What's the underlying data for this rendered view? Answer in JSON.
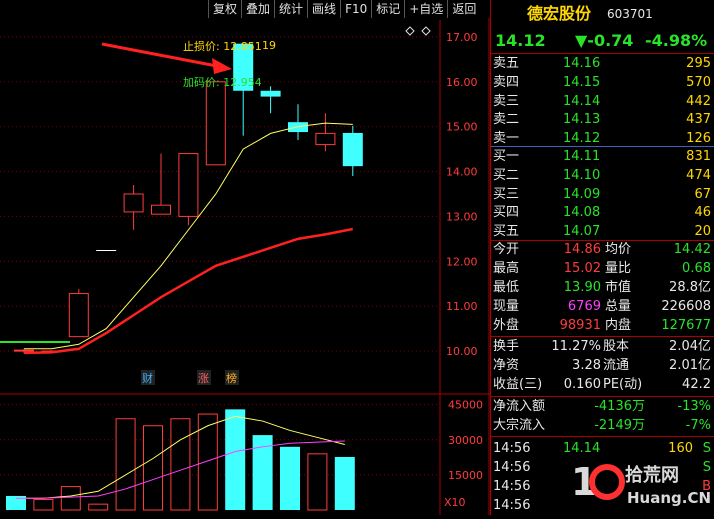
{
  "toolbar": [
    "复权",
    "叠加",
    "统计",
    "画线",
    "F10",
    "标记",
    "+自选",
    "返回"
  ],
  "stock": {
    "name": "德宏股份",
    "code": "603701",
    "price": "14.12",
    "change": "▼-0.74",
    "change_pct": "-4.98%"
  },
  "colors": {
    "up": "#ff3c3c",
    "down": "#40ffff",
    "ma1": "#ffff66",
    "ma2": "#ff2020",
    "vol_ma2": "#ff40ff",
    "grid": "#800000"
  },
  "sell": [
    {
      "label": "卖五",
      "price": "14.16",
      "vol": "295"
    },
    {
      "label": "卖四",
      "price": "14.15",
      "vol": "570"
    },
    {
      "label": "卖三",
      "price": "14.14",
      "vol": "442"
    },
    {
      "label": "卖二",
      "price": "14.13",
      "vol": "437"
    },
    {
      "label": "卖一",
      "price": "14.12",
      "vol": "126"
    }
  ],
  "buy": [
    {
      "label": "买一",
      "price": "14.11",
      "vol": "831"
    },
    {
      "label": "买二",
      "price": "14.10",
      "vol": "474"
    },
    {
      "label": "买三",
      "price": "14.09",
      "vol": "67"
    },
    {
      "label": "买四",
      "price": "14.08",
      "vol": "46"
    },
    {
      "label": "买五",
      "price": "14.07",
      "vol": "20"
    }
  ],
  "stats": [
    {
      "l1": "今开",
      "v1": "14.86",
      "c1": "red",
      "l2": "均价",
      "v2": "14.42",
      "c2": "green"
    },
    {
      "l1": "最高",
      "v1": "15.02",
      "c1": "red",
      "l2": "量比",
      "v2": "0.68",
      "c2": "green"
    },
    {
      "l1": "最低",
      "v1": "13.90",
      "c1": "green",
      "l2": "市值",
      "v2": "28.8亿",
      "c2": "white"
    },
    {
      "l1": "现量",
      "v1": "6769",
      "c1": "magenta",
      "l2": "总量",
      "v2": "226608",
      "c2": "white"
    },
    {
      "l1": "外盘",
      "v1": "98931",
      "c1": "red",
      "l2": "内盘",
      "v2": "127677",
      "c2": "green"
    }
  ],
  "fund": [
    {
      "l1": "换手",
      "v1": "11.27%",
      "l2": "股本",
      "v2": "2.04亿"
    },
    {
      "l1": "净资",
      "v1": "3.28",
      "l2": "流通",
      "v2": "2.01亿"
    },
    {
      "l1": "收益(三)",
      "v1": "0.160",
      "l2": "PE(动)",
      "v2": "42.2"
    }
  ],
  "flow": [
    {
      "label": "净流入额",
      "v1": "-4136万",
      "v2": "-13%"
    },
    {
      "label": "大宗流入",
      "v1": "-2149万",
      "v2": "-7%"
    }
  ],
  "ticks": [
    {
      "time": "14:56",
      "price": "14.14",
      "vol": "160",
      "flag": "S"
    },
    {
      "time": "14:56",
      "price": "",
      "vol": "",
      "flag": "S"
    },
    {
      "time": "14:56",
      "price": "",
      "vol": "",
      "flag": "B"
    },
    {
      "time": "14:56",
      "price": "",
      "vol": "",
      "flag": ""
    }
  ],
  "watermark": "10 拾荒网 Huang.CN",
  "annotations": {
    "stop": "止损价: 12.851",
    "stop_overlap": "19",
    "add": "加码价: 12.954"
  },
  "markers": {
    "cai": "财",
    "zhang": "涨",
    "bang": "榜"
  },
  "vol_multiplier": "X10",
  "chart_data": [
    {
      "type": "candlestick",
      "y_ticks": [
        10.0,
        11.0,
        12.0,
        13.0,
        14.0,
        15.0,
        16.0,
        17.0
      ],
      "ylim": [
        9.8,
        17.6
      ],
      "candles": [
        {
          "o": 10.02,
          "h": 10.05,
          "l": 9.95,
          "c": 10.0,
          "dir": "up"
        },
        {
          "o": 10.0,
          "h": 10.02,
          "l": 9.95,
          "c": 9.98,
          "dir": "up"
        },
        {
          "o": 10.32,
          "h": 11.38,
          "l": 10.32,
          "c": 11.28,
          "dir": "up"
        },
        {
          "o": 12.24,
          "h": 12.24,
          "l": 12.24,
          "c": 12.24,
          "dir": "flat"
        },
        {
          "o": 13.1,
          "h": 13.7,
          "l": 12.7,
          "c": 13.5,
          "dir": "up"
        },
        {
          "o": 13.05,
          "h": 14.4,
          "l": 13.05,
          "c": 13.25,
          "dir": "up"
        },
        {
          "o": 13.0,
          "h": 14.4,
          "l": 12.8,
          "c": 14.4,
          "dir": "up"
        },
        {
          "o": 14.15,
          "h": 16.0,
          "l": 14.15,
          "c": 16.0,
          "dir": "up"
        },
        {
          "o": 16.85,
          "h": 16.85,
          "l": 14.8,
          "c": 15.8,
          "dir": "down"
        },
        {
          "o": 15.8,
          "h": 15.9,
          "l": 15.3,
          "c": 15.67,
          "dir": "down"
        },
        {
          "o": 15.1,
          "h": 15.5,
          "l": 14.7,
          "c": 14.88,
          "dir": "down"
        },
        {
          "o": 14.85,
          "h": 15.3,
          "l": 14.45,
          "c": 14.6,
          "dir": "up"
        },
        {
          "o": 14.86,
          "h": 15.02,
          "l": 13.9,
          "c": 14.12,
          "dir": "down"
        }
      ],
      "ma_fast": [
        10.05,
        10.05,
        10.15,
        10.5,
        11.2,
        11.9,
        12.7,
        13.5,
        14.5,
        14.85,
        15.0,
        15.08,
        15.05
      ],
      "ma_slow": [
        9.96,
        9.97,
        10.05,
        10.4,
        10.8,
        11.2,
        11.55,
        11.9,
        12.1,
        12.3,
        12.5,
        12.6,
        12.72
      ]
    },
    {
      "type": "bar",
      "y_ticks": [
        15000,
        30000,
        45000
      ],
      "ylim": [
        0,
        47000
      ],
      "values": [
        6000,
        4500,
        10000,
        2500,
        39000,
        36000,
        39000,
        41000,
        43000,
        32000,
        27000,
        24000,
        22660
      ],
      "dirs": [
        "down",
        "up",
        "up",
        "up",
        "up",
        "up",
        "up",
        "up",
        "down",
        "down",
        "down",
        "up",
        "down"
      ],
      "ma_fast": [
        5000,
        5000,
        6000,
        8000,
        15000,
        22000,
        30000,
        36000,
        40000,
        38000,
        34000,
        31000,
        28000
      ],
      "ma_slow": [
        5000,
        5000,
        5500,
        6000,
        9000,
        13000,
        17000,
        21000,
        25000,
        27000,
        28500,
        29000,
        29500
      ]
    }
  ]
}
